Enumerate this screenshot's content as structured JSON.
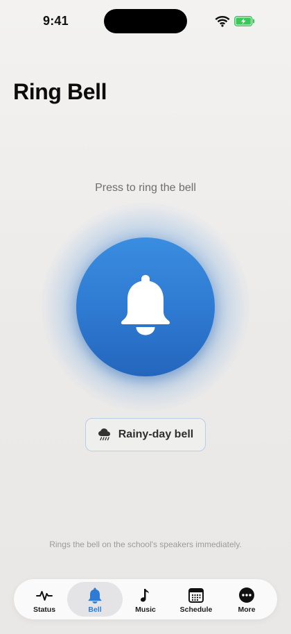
{
  "status_bar": {
    "time": "9:41"
  },
  "page": {
    "title": "Ring Bell"
  },
  "bell": {
    "prompt": "Press to ring the bell",
    "rainy_label": "Rainy-day bell",
    "footnote": "Rings the bell on the school's speakers immediately."
  },
  "colors": {
    "accent": "#2f7bd3",
    "accent_dark": "#2466bd",
    "battery": "#3cc75a"
  },
  "tabs": [
    {
      "label": "Status",
      "icon": "waveform-icon",
      "active": false
    },
    {
      "label": "Bell",
      "icon": "bell-icon",
      "active": true
    },
    {
      "label": "Music",
      "icon": "music-note-icon",
      "active": false
    },
    {
      "label": "Schedule",
      "icon": "calendar-icon",
      "active": false
    },
    {
      "label": "More",
      "icon": "more-icon",
      "active": false
    }
  ]
}
